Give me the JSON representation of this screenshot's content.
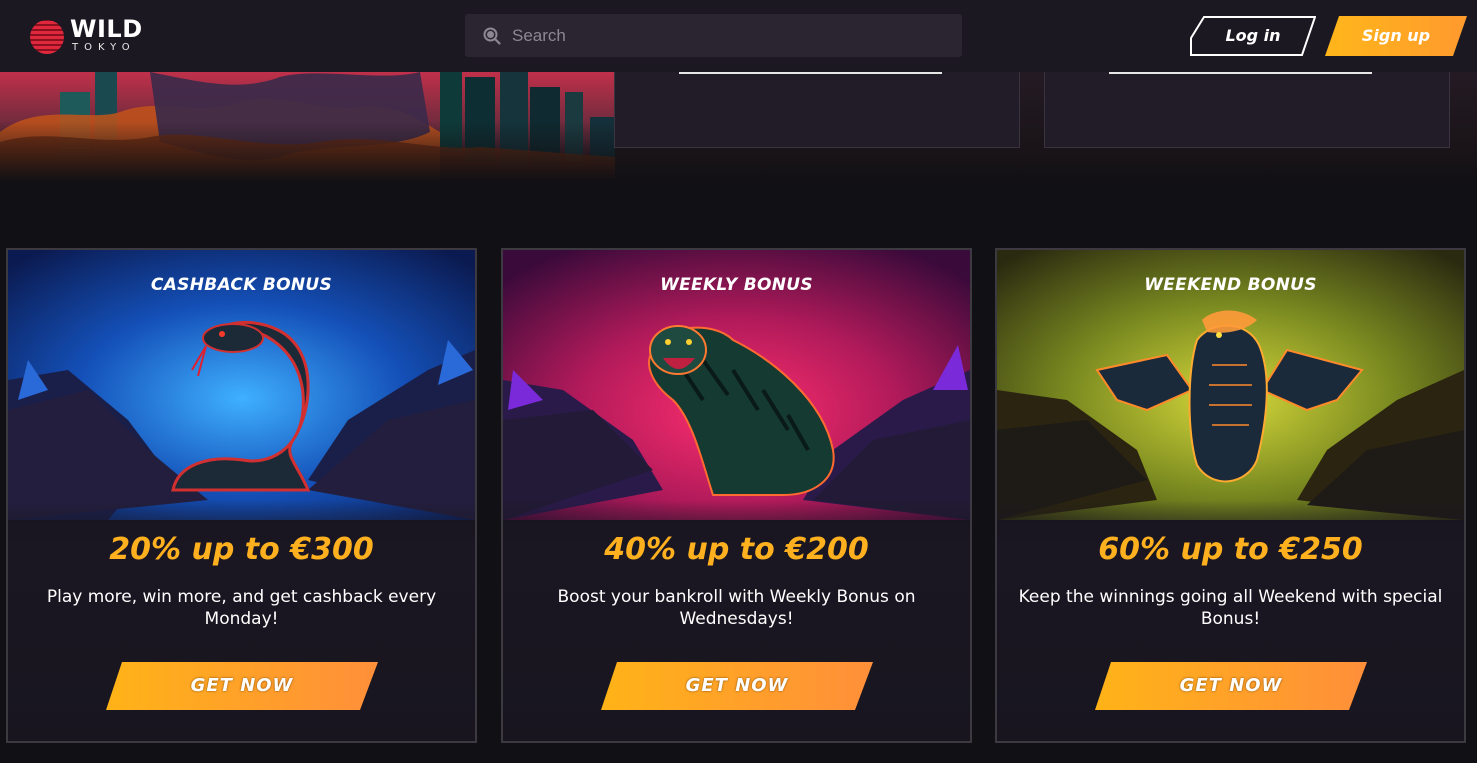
{
  "brand": {
    "name": "WILD",
    "subtitle": "TOKYO"
  },
  "search": {
    "placeholder": "Search"
  },
  "auth": {
    "login_label": "Log in",
    "signup_label": "Sign up"
  },
  "colors": {
    "accent": "#ffb01f",
    "background": "#111014",
    "header": "#1c1822"
  },
  "promos": [
    {
      "title": "CASHBACK BONUS",
      "amount": "20% up to €300",
      "description": "Play more, win more, and get cashback every Monday!",
      "cta": "GET NOW",
      "icon": "snake-icon"
    },
    {
      "title": "WEEKLY BONUS",
      "amount": "40% up to €200",
      "description": "Boost your bankroll with Weekly Bonus on Wednesdays!",
      "cta": "GET NOW",
      "icon": "tiger-icon"
    },
    {
      "title": "WEEKEND BONUS",
      "amount": "60% up to €250",
      "description": "Keep the winnings going all Weekend with special Bonus!",
      "cta": "GET NOW",
      "icon": "dragon-icon"
    }
  ]
}
